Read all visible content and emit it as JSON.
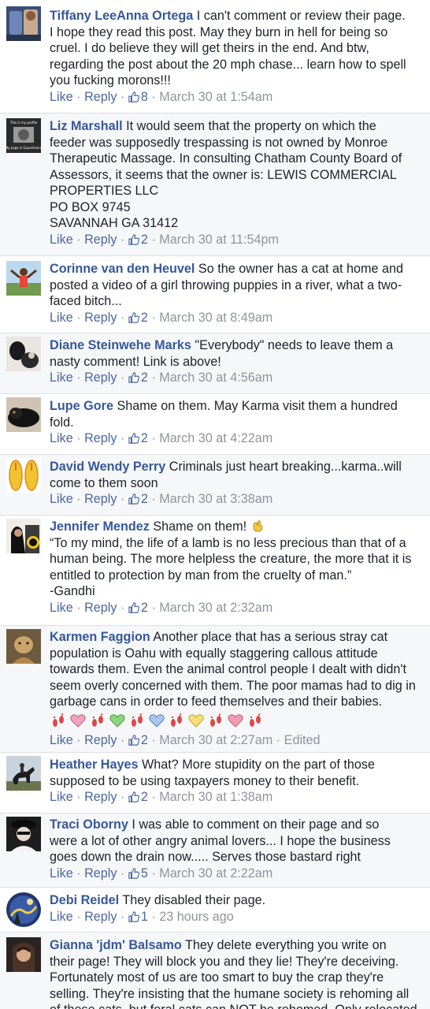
{
  "actions": {
    "like": "Like",
    "reply": "Reply",
    "dot": "·"
  },
  "comments": [
    {
      "name": "Tiffany LeeAnna Ortega",
      "lines": [
        " I can't comment or review their page.",
        "I hope they read this post. May they burn in hell for being so",
        "cruel. I do believe they will get theirs in the end. And btw,",
        "regarding the post about the 20 mph chase... learn how to spell",
        "you fucking morons!!!"
      ],
      "likes": "8",
      "time": "March 30 at 1:54am"
    },
    {
      "name": "Liz Marshall",
      "avatar_text": "This is my profile / My page is Guardmanit",
      "lines": [
        " It would seem that the property on which the",
        "feeder was supposedly trespassing is not owned by Monroe",
        "Therapeutic Massage. In consulting Chatham County Board of",
        "Assessors, it seems that the owner is: LEWIS COMMERCIAL",
        "PROPERTIES LLC",
        "PO BOX 9745",
        "SAVANNAH GA 31412"
      ],
      "likes": "2",
      "time": "March 30 at 11:54pm"
    },
    {
      "name": "Corinne van den Heuvel",
      "lines": [
        " So the owner has a cat at home and",
        "posted a video of a girl throwing puppies in a river, what a two-",
        "faced bitch..."
      ],
      "likes": "2",
      "time": "March 30 at 8:49am"
    },
    {
      "name": "Diane Steinwehe Marks",
      "lines": [
        " \"Everybody\" needs to leave them a",
        "nasty comment! Link is above!"
      ],
      "likes": "2",
      "time": "March 30 at 4:56am"
    },
    {
      "name": "Lupe Gore",
      "lines": [
        " Shame on them. May Karma visit them a hundred",
        "fold."
      ],
      "likes": "2",
      "time": "March 30 at 4:22am"
    },
    {
      "name": "David Wendy Perry",
      "lines": [
        " Criminals just heart breaking...karma..will",
        "come to them soon"
      ],
      "likes": "2",
      "time": "March 30 at 3:38am"
    },
    {
      "name": "Jennifer Mendez",
      "lines": [
        " Shame on them! ",
        "“To my mind, the life of a lamb is no less precious than that of a",
        "human being. The more helpless the creature, the more that it is",
        "entitled to protection by man from the cruelty of man.”",
        "-Gandhi"
      ],
      "likes": "2",
      "time": "March 30 at 2:32am"
    },
    {
      "name": "Karmen Faggion",
      "lines": [
        " Another place that has a serious stray cat",
        "population is Oahu with equally staggering callous attitude",
        "towards them. Even the animal control people I dealt with didn't",
        "seem overly concerned with them. The poor mamas had to dig in",
        "garbage cans in order to feed themselves and their babies."
      ],
      "likes": "2",
      "time": "March 30 at 2:27am",
      "edited": "Edited",
      "emoji_colors": [
        "#f2a3c0",
        "#8fd47f",
        "#a9c6ef",
        "#f5e07a",
        "#f29bb3"
      ]
    },
    {
      "name": "Heather Hayes",
      "lines": [
        " What? More stupidity on the part of those",
        "supposed to be using taxpayers money to their benefit."
      ],
      "likes": "2",
      "time": "March 30 at 1:38am"
    },
    {
      "name": "Traci Oborny",
      "lines": [
        " I was able to comment on their page and so",
        "were a lot of other angry animal lovers... I hope the business",
        "goes down the drain now..... Serves those bastard right"
      ],
      "likes": "5",
      "time": "March 30 at 2:22am"
    },
    {
      "name": "Debi Reidel",
      "lines": [
        " They disabled their page."
      ],
      "likes": "1",
      "time": "23 hours ago"
    },
    {
      "name": "Gianna 'jdm' Balsamo",
      "lines": [
        " They delete everything you write on",
        "their page! They will block you and they lie! They're deceiving.",
        "Fortunately most of us are too smart to buy the crap they're",
        "selling. They're insisting that the humane society is rehoming all",
        "of these cats, but feral cats can NOT be rehomed. Only relocated"
      ],
      "likes": "",
      "time": ""
    }
  ]
}
